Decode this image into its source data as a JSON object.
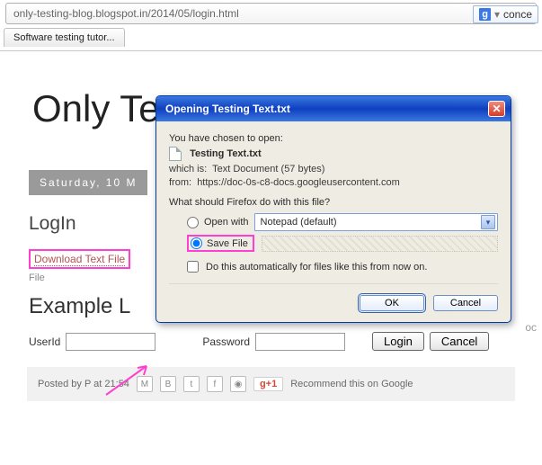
{
  "browser": {
    "url": "only-testing-blog.blogspot.in/2014/05/login.html",
    "search_query": "conce",
    "tab_title": "Software testing tutor..."
  },
  "page": {
    "site_title": "Only Te",
    "date_badge": "Saturday, 10 M",
    "post_title": "LogIn",
    "download_link": "Download Text File",
    "file_label": "File",
    "example_heading": "Example L",
    "userid_label": "UserId",
    "password_label": "Password",
    "login_btn": "Login",
    "cancel_btn": "Cancel",
    "trailing_text": "oc"
  },
  "footer": {
    "posted_by": "Posted by P at 21:54",
    "gplus": "g+1",
    "recommend": "Recommend this on Google"
  },
  "dialog": {
    "title": "Opening Testing Text.txt",
    "chosen": "You have chosen to open:",
    "filename": "Testing Text.txt",
    "which_is_label": "which is:",
    "which_is_value": "Text Document (57 bytes)",
    "from_label": "from:",
    "from_value": "https://doc-0s-c8-docs.googleusercontent.com",
    "prompt": "What should Firefox do with this file?",
    "open_with": "Open with",
    "open_with_value": "Notepad (default)",
    "save_file": "Save File",
    "auto_label": "Do this automatically for files like this from now on.",
    "ok": "OK",
    "cancel": "Cancel"
  }
}
